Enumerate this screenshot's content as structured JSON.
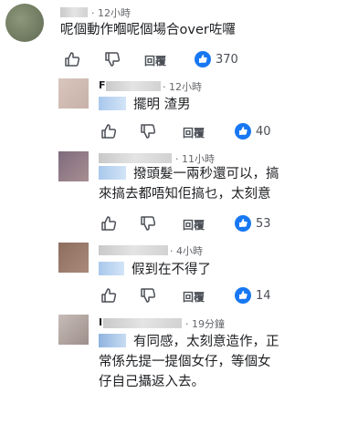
{
  "comments": [
    {
      "time": "· 12小時",
      "text": "呢個動作嗰呢個場合over咗囉",
      "reply_label": "回覆",
      "likes": "370"
    },
    {
      "name_initial": "F",
      "time": "· 12小時",
      "text": "擺明 渣男",
      "reply_label": "回覆",
      "likes": "40"
    },
    {
      "time": "· 11小時",
      "text_line1": "撥頭髮一兩秒還可以，搞",
      "text_line2": "來搞去都唔知佢搞乜，太刻意",
      "reply_label": "回覆",
      "likes": "53"
    },
    {
      "time": "· 4小時",
      "text": "假到在不得了",
      "reply_label": "回覆",
      "likes": "14"
    },
    {
      "name_initial": "I",
      "time": "· 19分鐘",
      "text_line1": "有同感，太刻意造作，正",
      "text_line2": "常係先提一提個女仔，等個女",
      "text_line3": "仔自己攝返入去。"
    }
  ],
  "icons": [
    "thumbs-up-outline-icon",
    "thumbs-down-outline-icon",
    "like-badge-icon"
  ],
  "colors": {
    "accent": "#1877f2",
    "meta": "#65676b",
    "text": "#1c1e21"
  }
}
